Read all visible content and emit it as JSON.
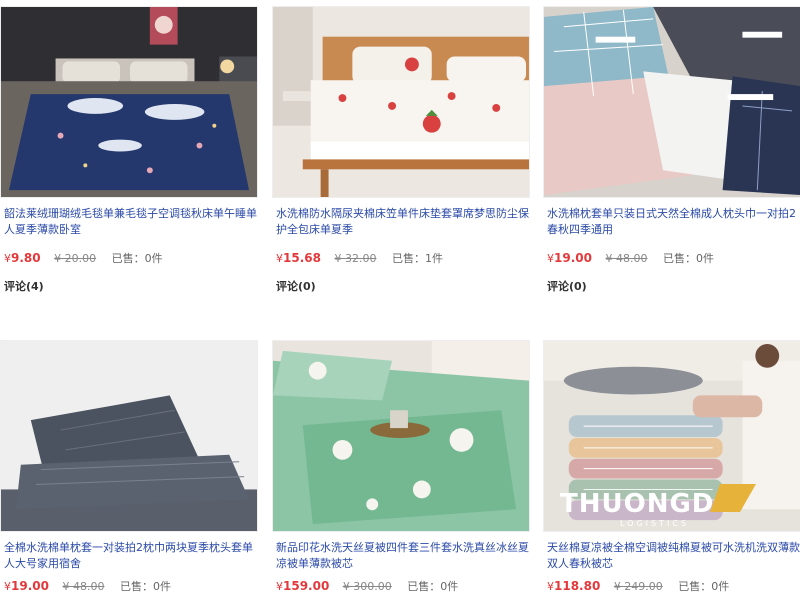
{
  "colors": {
    "price": "#e4393c",
    "title_link": "#2b4aa8",
    "muted": "#888888"
  },
  "products": [
    {
      "title": "韶法莱绒珊瑚绒毛毯单兼毛毯子空调毯秋床单午睡单人夏季薄款卧室",
      "currency": "¥",
      "price": "9.80",
      "old_price": "¥ 20.00",
      "sold": "已售：0件",
      "review": "评论(4)"
    },
    {
      "title": "水洗棉防水隔尿夹棉床笠单件床垫套罩席梦思防尘保护全包床单夏季",
      "currency": "¥",
      "price": "15.68",
      "old_price": "¥ 32.00",
      "sold": "已售：1件",
      "review": "评论(0)"
    },
    {
      "title": "水洗棉枕套单只装日式天然全棉成人枕头巾一对拍2春秋四季通用",
      "currency": "¥",
      "price": "19.00",
      "old_price": "¥ 48.00",
      "sold": "已售：0件",
      "review": "评论(0)"
    },
    {
      "title": "全棉水洗棉单枕套一对装拍2枕巾两块夏季枕头套单人大号家用宿舍",
      "currency": "¥",
      "price": "19.00",
      "old_price": "¥ 48.00",
      "sold": "已售：0件"
    },
    {
      "title": "新品印花水洗天丝夏被四件套三件套水洗真丝冰丝夏凉被单薄款被芯",
      "currency": "¥",
      "price": "159.00",
      "old_price": "¥ 300.00",
      "sold": "已售：0件"
    },
    {
      "title": "天丝棉夏凉被全棉空调被纯棉夏被可水洗机洗双薄款双人春秋被芯",
      "currency": "¥",
      "price": "118.80",
      "old_price": "¥ 249.00",
      "sold": "已售：0件"
    }
  ],
  "watermark": {
    "brand": "THUONGDO",
    "tagline": "LOGISTICS"
  }
}
